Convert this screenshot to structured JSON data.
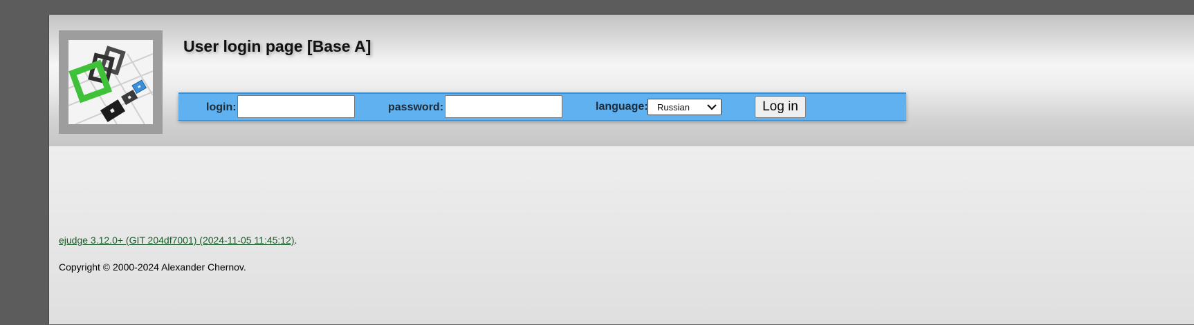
{
  "header": {
    "title": "User login page [Base A]"
  },
  "login_form": {
    "login_label": "login:",
    "login_value": "",
    "password_label": "password:",
    "password_value": "",
    "language_label": "language:",
    "language_selected": "Russian",
    "submit_label": "Log in"
  },
  "footer": {
    "version_link": "ejudge 3.12.0+ (GIT 204df7001) (2024-11-05 11:45:12)",
    "version_suffix": ".",
    "copyright": "Copyright © 2000-2024 Alexander Chernov."
  },
  "colors": {
    "login_bar": "#5fb1ef",
    "link": "#1a5b2a",
    "logo_green": "#3fc23a",
    "logo_blue": "#3b8fd8"
  },
  "icons": {
    "logo": "ejudge-logo-icon",
    "select_chevron": "chevron-down-icon"
  }
}
